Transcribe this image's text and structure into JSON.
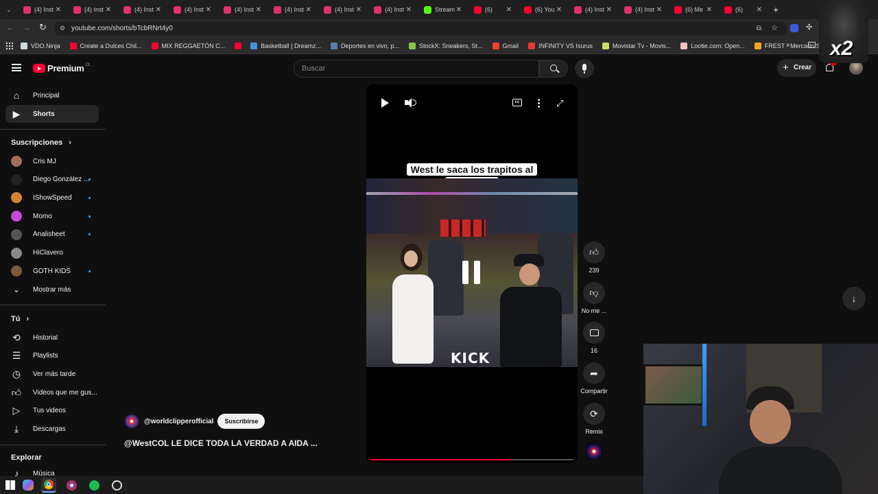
{
  "browser": {
    "tabs": [
      {
        "title": "(4) Inst",
        "color": "#e1306c"
      },
      {
        "title": "(4) Inst",
        "color": "#e1306c"
      },
      {
        "title": "(4) Inst",
        "color": "#e1306c"
      },
      {
        "title": "(4) Inst",
        "color": "#e1306c"
      },
      {
        "title": "(4) Inst",
        "color": "#e1306c"
      },
      {
        "title": "(4) Inst",
        "color": "#e1306c"
      },
      {
        "title": "(4) Inst",
        "color": "#e1306c"
      },
      {
        "title": "(4) Inst",
        "color": "#e1306c"
      },
      {
        "title": "Stream",
        "color": "#53fc18"
      },
      {
        "title": "(6)",
        "color": "#ff0033"
      },
      {
        "title": "(6) You",
        "color": "#ff0033"
      },
      {
        "title": "(4) Inst",
        "color": "#e1306c"
      },
      {
        "title": "(4) Inst",
        "color": "#e1306c"
      },
      {
        "title": "(6) Me",
        "color": "#ff0033"
      },
      {
        "title": "(6)",
        "color": "#ff0033"
      }
    ],
    "url": "youtube.com/shorts/bTcbRNrt4y0",
    "bookmarks": [
      {
        "label": "VDO.Ninja",
        "color": "#cfd8dc"
      },
      {
        "label": "Create a Dulces Chil...",
        "color": "#ff0033"
      },
      {
        "label": "MIX REGGAETÓN C...",
        "color": "#ff0033"
      },
      {
        "label": "",
        "color": "#ff0033"
      },
      {
        "label": "Basketball | Dreamz...",
        "color": "#4a90d9"
      },
      {
        "label": "Deportes en vivo, p...",
        "color": "#5b7fa8"
      },
      {
        "label": "StockX: Sneakers, St...",
        "color": "#8bc34a"
      },
      {
        "label": "Gmail",
        "color": "#ea4335"
      },
      {
        "label": "INFINITY VS Isurus",
        "color": "#e53935"
      },
      {
        "label": "Movistar Tv - Movis...",
        "color": "#c6e06a"
      },
      {
        "label": "Lootie.com: Open...",
        "color": "#f0c0c0"
      },
      {
        "label": "FREST - Mercado Sa...",
        "color": "#f5a623"
      }
    ]
  },
  "header": {
    "logo": "Premium",
    "region": "CL",
    "search_placeholder": "Buscar",
    "create_label": "Crear",
    "notif_count": "6"
  },
  "sidebar": {
    "main": [
      {
        "label": "Principal",
        "icon": "home-icon"
      },
      {
        "label": "Shorts",
        "icon": "shorts-icon",
        "active": true
      }
    ],
    "subs_title": "Suscripciones",
    "subs": [
      {
        "label": "Cris MJ",
        "color": "#a0705a",
        "dot": false
      },
      {
        "label": "Diego González ...",
        "color": "#222222",
        "dot": true
      },
      {
        "label": "IShowSpeed",
        "color": "#d6832e",
        "dot": true
      },
      {
        "label": "Momo",
        "color": "#c44bd6",
        "dot": true
      },
      {
        "label": "Analisheet",
        "color": "#555555",
        "dot": true
      },
      {
        "label": "HiClavero",
        "color": "#888888",
        "dot": false
      },
      {
        "label": "GOTH KIDS",
        "color": "#7a5a3a",
        "dot": true
      }
    ],
    "show_more": "Mostrar más",
    "you_title": "Tú",
    "you": [
      {
        "label": "Historial",
        "icon": "history-icon"
      },
      {
        "label": "Playlists",
        "icon": "playlist-icon"
      },
      {
        "label": "Ver más tarde",
        "icon": "clock-icon"
      },
      {
        "label": "Videos que me gus...",
        "icon": "like-icon"
      },
      {
        "label": "Tus videos",
        "icon": "video-icon"
      },
      {
        "label": "Descargas",
        "icon": "download-icon"
      }
    ],
    "explore_title": "Explorar",
    "explore": [
      {
        "label": "Música",
        "icon": "music-icon"
      }
    ]
  },
  "short": {
    "caption": "West le saca los trapitos al sol a Aida",
    "watermark": "KICK",
    "progress": 0.69,
    "channel": "@worldclipperofficial",
    "subscribe": "Suscribirse",
    "title": "@WestCOL LE DICE TODA LA VERDAD A AIDA ..."
  },
  "actions": {
    "likes": "239",
    "dislike": "No me ...",
    "comments": "16",
    "share": "Compartir",
    "remix": "Remix"
  },
  "overlay": {
    "badge": "x2"
  }
}
